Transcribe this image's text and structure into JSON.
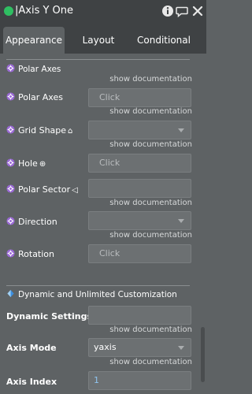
{
  "window": {
    "title": "|Axis Y One",
    "status_color": "#2fbf62",
    "icons": [
      "info-icon",
      "comment-icon",
      "close-icon"
    ]
  },
  "tabs": [
    {
      "label": "Appearance",
      "active": true
    },
    {
      "label": "Layout",
      "active": false
    },
    {
      "label": "Conditional",
      "active": false
    }
  ],
  "doc_link_text": "show documentation",
  "polar_section": {
    "title": "Polar Axes",
    "properties": [
      {
        "label": "Polar Axes",
        "control": "input",
        "placeholder": "Click"
      },
      {
        "label": "Grid Shape",
        "glyph": "⌂",
        "control": "select",
        "value": ""
      },
      {
        "label": "Hole",
        "glyph": "⊕",
        "control": "input",
        "placeholder": "Click"
      },
      {
        "label": "Polar Sector",
        "glyph": "◁",
        "control": "input",
        "placeholder": ""
      },
      {
        "label": "Direction",
        "control": "select",
        "value": ""
      },
      {
        "label": "Rotation",
        "control": "input",
        "placeholder": "Click"
      }
    ]
  },
  "dynamic_section": {
    "title": "Dynamic and Unlimited Customization",
    "properties": [
      {
        "label": "Dynamic Settings { }",
        "control": "input",
        "placeholder": ""
      },
      {
        "label": "Axis Mode",
        "control": "select",
        "value": "yaxis"
      },
      {
        "label": "Axis Index",
        "control": "input",
        "value": "1"
      }
    ]
  },
  "colors": {
    "panel_bg": "#5e6264",
    "header_bg": "#3f4244",
    "field_bg": "#6c7072",
    "gear_purple": "#9b6ad6",
    "accent_blue": "#3d8fe0"
  }
}
